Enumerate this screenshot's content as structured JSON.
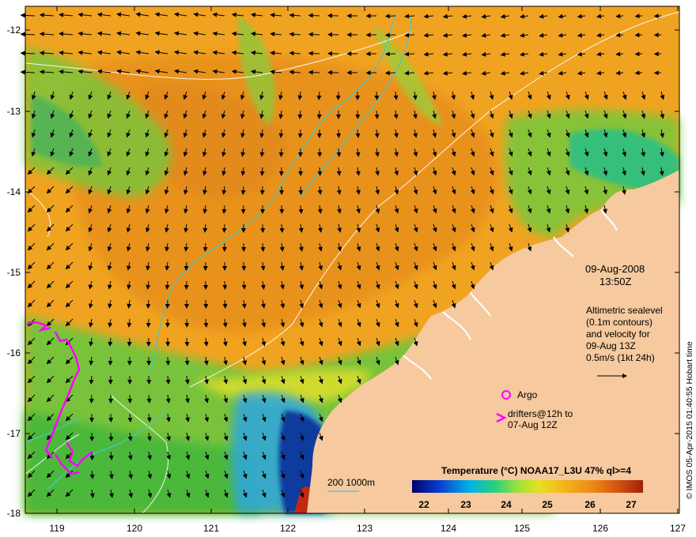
{
  "map": {
    "lat_ticks": [
      "-12",
      "-13",
      "-14",
      "-15",
      "-16",
      "-17",
      "-18"
    ],
    "lon_ticks": [
      "119",
      "120",
      "121",
      "122",
      "123",
      "124",
      "125",
      "126",
      "127"
    ],
    "date": "09-Aug-2008",
    "time": "13:50Z",
    "altimetry_lines": [
      "Altimetric sealevel",
      "(0.1m contours)",
      "and velocity for",
      "09-Aug 13Z",
      "0.5m/s (1kt 24h)"
    ],
    "argo_label": "Argo",
    "drifters_lines": [
      "drifters@12h to",
      "07-Aug 12Z"
    ],
    "bathymetry_label": "200  1000m",
    "colorbar_title": "Temperature (°C) NOAA17_L3U 47% ql>=4",
    "colorbar_ticks": [
      "22",
      "23",
      "24",
      "25",
      "26",
      "27"
    ],
    "credit": "© IMOS 05-Apr-2015 01:40:55 Hobart time",
    "colors": {
      "ocean_warm": "#f0a321",
      "ocean_orange": "#e8921e",
      "ocean_green": "#5cc338",
      "ocean_cold": "#0a3a9e",
      "land": "#f6c99e",
      "drifters": "#ff00ff",
      "bathymetry": "#41c9c9",
      "contours": "#ffffff"
    },
    "icons": [
      "velocity-arrow-icon",
      "argo-float-icon",
      "drifter-track-icon"
    ]
  }
}
